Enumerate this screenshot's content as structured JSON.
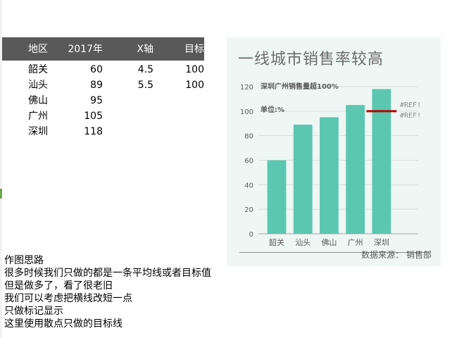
{
  "table": {
    "headers": [
      "地区",
      "2017年",
      "X轴",
      "目标"
    ],
    "rows": [
      [
        "韶关",
        "60",
        "4.5",
        "100"
      ],
      [
        "汕头",
        "89",
        "5.5",
        "100"
      ],
      [
        "佛山",
        "95",
        "",
        ""
      ],
      [
        "广州",
        "105",
        "",
        ""
      ],
      [
        "深圳",
        "118",
        "",
        ""
      ]
    ]
  },
  "chart": {
    "title": "一线城市销售率较高",
    "subtitle": "深圳广州销售量超100%",
    "unit_label": "单位:%",
    "ref_labels": [
      "#REF!",
      "#REF!"
    ],
    "source": "数据来源：  销售部"
  },
  "chart_data": {
    "type": "bar",
    "categories": [
      "韶关",
      "汕头",
      "佛山",
      "广州",
      "深圳"
    ],
    "values": [
      60,
      89,
      95,
      105,
      118
    ],
    "title": "一线城市销售率较高",
    "xlabel": "",
    "ylabel": "",
    "ylim": [
      0,
      120
    ],
    "yticks": [
      0,
      20,
      40,
      60,
      80,
      100,
      120
    ],
    "grid": true,
    "target_value": 100,
    "target_category": "深圳",
    "colors": {
      "bar": "#5bc7b0",
      "target_line": "#c00000",
      "grid": "#d9d9d9",
      "axis_text": "#595959"
    }
  },
  "notes": [
    "作图思路",
    "很多时候我们只做的都是一条平均线或者目标值",
    "但是做多了，看了很老旧",
    "我们可以考虑把横线改短一点",
    "只做标记显示",
    "这里使用散点只做的目标线"
  ]
}
